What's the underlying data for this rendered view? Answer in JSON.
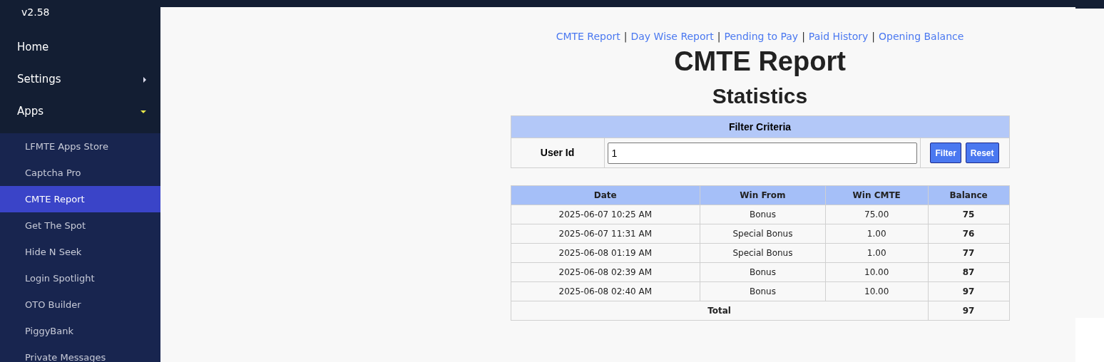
{
  "sidebar": {
    "version": "v2.58",
    "menu": [
      {
        "label": "Home",
        "kind": "link"
      },
      {
        "label": "Settings",
        "kind": "menu",
        "expanded": false
      },
      {
        "label": "Apps",
        "kind": "menu",
        "expanded": true,
        "children": [
          {
            "label": "LFMTE Apps Store",
            "selected": false
          },
          {
            "label": "Captcha Pro",
            "selected": false
          },
          {
            "label": "CMTE Report",
            "selected": true
          },
          {
            "label": "Get The Spot",
            "selected": false
          },
          {
            "label": "Hide N Seek",
            "selected": false
          },
          {
            "label": "Login Spotlight",
            "selected": false
          },
          {
            "label": "OTO Builder",
            "selected": false
          },
          {
            "label": "PiggyBank",
            "selected": false
          },
          {
            "label": "Private Messages",
            "selected": false
          }
        ]
      }
    ]
  },
  "nav_links": [
    "CMTE Report",
    "Day Wise Report",
    "Pending to Pay",
    "Paid History",
    "Opening Balance"
  ],
  "separator": "|",
  "title": "CMTE Report",
  "subtitle": "Statistics",
  "filter": {
    "header": "Filter Criteria",
    "label": "User Id",
    "value": "1",
    "buttons": [
      "Filter",
      "Reset"
    ]
  },
  "table": {
    "columns": [
      "Date",
      "Win From",
      "Win CMTE",
      "Balance"
    ],
    "rows": [
      [
        "2025-06-07 10:25 AM",
        "Bonus",
        "75.00",
        "75"
      ],
      [
        "2025-06-07 11:31 AM",
        "Special Bonus",
        "1.00",
        "76"
      ],
      [
        "2025-06-08 01:19 AM",
        "Special Bonus",
        "1.00",
        "77"
      ],
      [
        "2025-06-08 02:39 AM",
        "Bonus",
        "10.00",
        "87"
      ],
      [
        "2025-06-08 02:40 AM",
        "Bonus",
        "10.00",
        "97"
      ]
    ],
    "total_label": "Total",
    "total_value": "97"
  }
}
